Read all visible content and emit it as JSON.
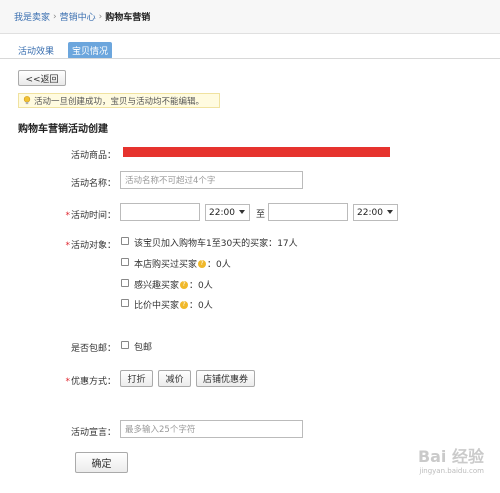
{
  "breadcrumb": {
    "items": [
      "我是卖家",
      "营销中心"
    ],
    "current": "购物车营销"
  },
  "tabs": [
    {
      "label": "活动效果",
      "active": false
    },
    {
      "label": "宝贝情况",
      "active": true
    }
  ],
  "back_button": "<<返回",
  "notice": "活动一旦创建成功，宝贝与活动均不能编辑。",
  "section_title": "购物车营销活动创建",
  "form": {
    "product_label": "活动商品：",
    "name_label": "活动名称：",
    "name_placeholder": "活动名称不可超过4个字",
    "time_label": "活动时间：",
    "time_start_hour": "22:00",
    "time_sep": "至",
    "time_end_hour": "22:00",
    "target_label": "活动对象：",
    "target_options": [
      {
        "label": "该宝贝加入购物车1至30天的买家：",
        "count": "17人",
        "help": false
      },
      {
        "label": "本店购买过买家",
        "count": "0人",
        "help": true
      },
      {
        "label": "感兴趣买家",
        "count": "0人",
        "help": true
      },
      {
        "label": "比价中买家",
        "count": "0人",
        "help": true
      }
    ],
    "shipping_label": "是否包邮：",
    "shipping_option": "包邮",
    "discount_label": "优惠方式：",
    "discount_buttons": [
      "打折",
      "减价",
      "店铺优惠券"
    ],
    "slogan_label": "活动宣言：",
    "slogan_placeholder": "最多输入25个字符",
    "submit": "确定"
  },
  "watermark": {
    "main": "Bai 经验",
    "sub": "jingyan.baidu.com"
  },
  "colors": {
    "accent": "#3a6fb0",
    "required": "#e0262f",
    "redacted": "#e6332e"
  }
}
